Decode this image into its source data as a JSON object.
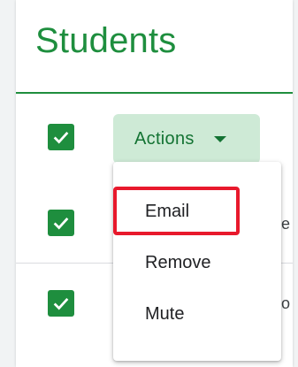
{
  "header": {
    "title": "Students"
  },
  "actions_button": {
    "label": "Actions",
    "icon": "caret-down-icon"
  },
  "rows": [
    {
      "checked": true,
      "partial_text": ""
    },
    {
      "checked": true,
      "partial_text": "e"
    },
    {
      "checked": true,
      "partial_text": "o"
    }
  ],
  "menu": {
    "items": [
      {
        "label": "Email",
        "highlighted": true
      },
      {
        "label": "Remove",
        "highlighted": false
      },
      {
        "label": "Mute",
        "highlighted": false
      }
    ]
  },
  "colors": {
    "brand_green": "#1e8e3e",
    "button_bg": "#ceead6",
    "highlight_red": "#e8192c"
  }
}
